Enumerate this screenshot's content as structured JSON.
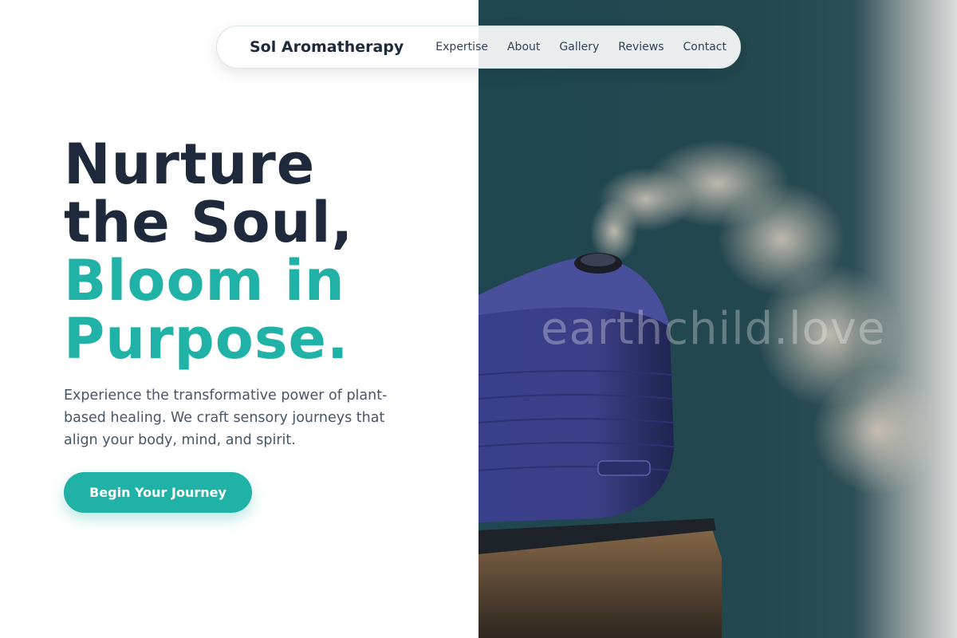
{
  "nav": {
    "brand": "Sol Aromatherapy",
    "links": [
      "Expertise",
      "About",
      "Gallery",
      "Reviews",
      "Contact"
    ]
  },
  "hero": {
    "headline_dark": [
      "Nurture",
      "the Soul,"
    ],
    "headline_teal": [
      "Bloom in",
      "Purpose."
    ],
    "subtext": "Experience the transformative power of plant-based healing. We craft sensory journeys that align your body, mind, and spirit.",
    "cta_label": "Begin Your Journey"
  },
  "photo": {
    "watermark": "earthchild.love"
  },
  "colors": {
    "accent": "#20b2a6",
    "heading": "#1e293b",
    "body_text": "#475569"
  }
}
